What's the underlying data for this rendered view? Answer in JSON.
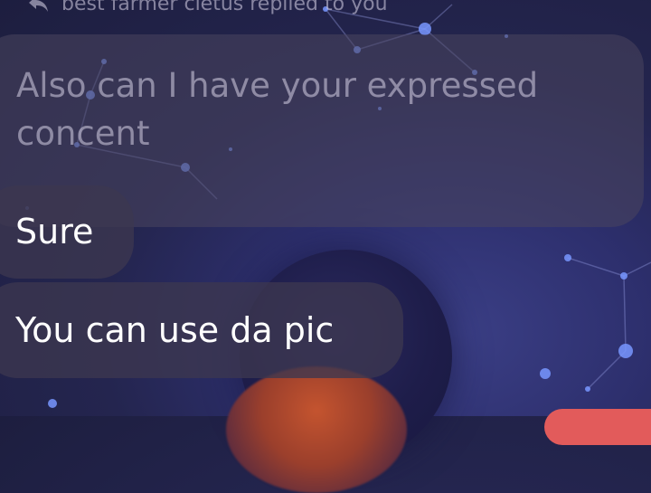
{
  "reply": {
    "header_text": "best farmer cletus replied to you",
    "icon": "reply-icon"
  },
  "messages": {
    "quoted_text": "Also can I have your expressed concent",
    "message_1": "Sure",
    "message_2": "You can use da pic"
  },
  "colors": {
    "background": "#24254f",
    "bubble": "#3c3750",
    "quoted_text": "#d7d2e6",
    "accent": "#e25b5b"
  }
}
